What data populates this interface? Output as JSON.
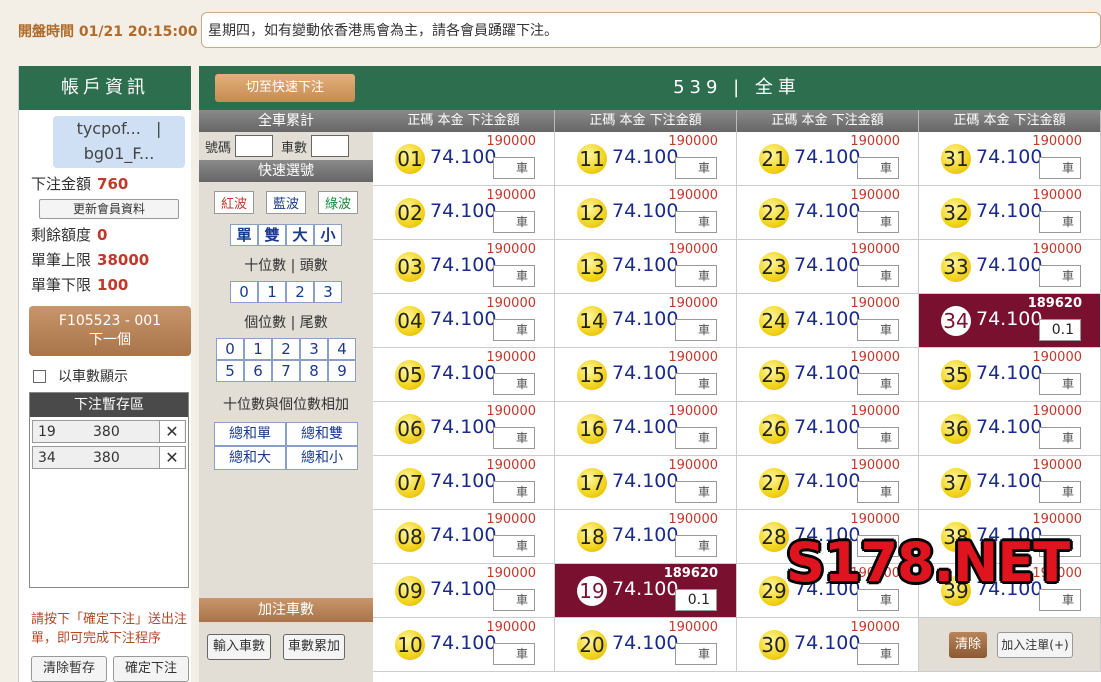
{
  "header": {
    "open_time": "開盤時間 01/21 20:15:00",
    "notice": "星期四，如有變動依香港馬會為主，請各會員踴躍下注。"
  },
  "account": {
    "title": "帳戶資訊",
    "user_line1": "tycpof...",
    "user_sep": "|",
    "user_line2": "bg01_F...",
    "bet_amount_label": "下注金額",
    "bet_amount": "760",
    "update_btn": "更新會員資料",
    "remaining_label": "剩餘額度",
    "remaining": "0",
    "max_label": "單筆上限",
    "max": "38000",
    "min_label": "單筆下限",
    "min": "100",
    "next_line1": "F105523 - 001",
    "next_line2": "下一個",
    "show_by_count": "以車數顯示",
    "staging_title": "下注暫存區",
    "staging": [
      {
        "num": "19",
        "amt": "380"
      },
      {
        "num": "34",
        "amt": "380"
      }
    ],
    "note": "請按下「確定下注」送出注單，即可完成下注程序",
    "clear_btn": "清除暫存",
    "confirm_btn": "確定下注"
  },
  "quick": {
    "fast_btn": "切至快速下注",
    "total_title": "全車累計",
    "num_label": "號碼",
    "count_label": "車數",
    "quick_title": "快速選號",
    "waves": [
      "紅波",
      "藍波",
      "綠波"
    ],
    "parity": [
      "單",
      "雙",
      "大",
      "小"
    ],
    "tens_label": "十位數 | 頭數",
    "tens": [
      "0",
      "1",
      "2",
      "3"
    ],
    "units_label": "個位數 | 尾數",
    "units_row1": [
      "0",
      "1",
      "2",
      "3",
      "4"
    ],
    "units_row2": [
      "5",
      "6",
      "7",
      "8",
      "9"
    ],
    "sum_label": "十位數與個位數相加",
    "sums": [
      "總和單",
      "總和雙",
      "總和大",
      "總和小"
    ],
    "add_title": "加注車數",
    "input_btn": "輸入車數",
    "accum_btn": "車數累加"
  },
  "board": {
    "title": "539 | 全車",
    "col_head": "正碼  本金  下注金額",
    "car_label": "車",
    "clear_btn": "清除",
    "add_btn": "加入注單(+)",
    "columns": [
      [
        {
          "n": "01",
          "odds": "74.100",
          "limit": "190000",
          "val": ""
        },
        {
          "n": "02",
          "odds": "74.100",
          "limit": "190000",
          "val": ""
        },
        {
          "n": "03",
          "odds": "74.100",
          "limit": "190000",
          "val": ""
        },
        {
          "n": "04",
          "odds": "74.100",
          "limit": "190000",
          "val": ""
        },
        {
          "n": "05",
          "odds": "74.100",
          "limit": "190000",
          "val": ""
        },
        {
          "n": "06",
          "odds": "74.100",
          "limit": "190000",
          "val": ""
        },
        {
          "n": "07",
          "odds": "74.100",
          "limit": "190000",
          "val": ""
        },
        {
          "n": "08",
          "odds": "74.100",
          "limit": "190000",
          "val": ""
        },
        {
          "n": "09",
          "odds": "74.100",
          "limit": "190000",
          "val": ""
        },
        {
          "n": "10",
          "odds": "74.100",
          "limit": "190000",
          "val": ""
        }
      ],
      [
        {
          "n": "11",
          "odds": "74.100",
          "limit": "190000",
          "val": ""
        },
        {
          "n": "12",
          "odds": "74.100",
          "limit": "190000",
          "val": ""
        },
        {
          "n": "13",
          "odds": "74.100",
          "limit": "190000",
          "val": ""
        },
        {
          "n": "14",
          "odds": "74.100",
          "limit": "190000",
          "val": ""
        },
        {
          "n": "15",
          "odds": "74.100",
          "limit": "190000",
          "val": ""
        },
        {
          "n": "16",
          "odds": "74.100",
          "limit": "190000",
          "val": ""
        },
        {
          "n": "17",
          "odds": "74.100",
          "limit": "190000",
          "val": ""
        },
        {
          "n": "18",
          "odds": "74.100",
          "limit": "190000",
          "val": ""
        },
        {
          "n": "19",
          "odds": "74.100",
          "limit": "189620",
          "val": "0.1",
          "selected": true
        },
        {
          "n": "20",
          "odds": "74.100",
          "limit": "190000",
          "val": ""
        }
      ],
      [
        {
          "n": "21",
          "odds": "74.100",
          "limit": "190000",
          "val": ""
        },
        {
          "n": "22",
          "odds": "74.100",
          "limit": "190000",
          "val": ""
        },
        {
          "n": "23",
          "odds": "74.100",
          "limit": "190000",
          "val": ""
        },
        {
          "n": "24",
          "odds": "74.100",
          "limit": "190000",
          "val": ""
        },
        {
          "n": "25",
          "odds": "74.100",
          "limit": "190000",
          "val": ""
        },
        {
          "n": "26",
          "odds": "74.100",
          "limit": "190000",
          "val": ""
        },
        {
          "n": "27",
          "odds": "74.100",
          "limit": "190000",
          "val": ""
        },
        {
          "n": "28",
          "odds": "74.100",
          "limit": "190000",
          "val": ""
        },
        {
          "n": "29",
          "odds": "74.100",
          "limit": "190000",
          "val": ""
        },
        {
          "n": "30",
          "odds": "74.100",
          "limit": "190000",
          "val": ""
        }
      ],
      [
        {
          "n": "31",
          "odds": "74.100",
          "limit": "190000",
          "val": ""
        },
        {
          "n": "32",
          "odds": "74.100",
          "limit": "190000",
          "val": ""
        },
        {
          "n": "33",
          "odds": "74.100",
          "limit": "190000",
          "val": ""
        },
        {
          "n": "34",
          "odds": "74.100",
          "limit": "189620",
          "val": "0.1",
          "selected": true
        },
        {
          "n": "35",
          "odds": "74.100",
          "limit": "190000",
          "val": ""
        },
        {
          "n": "36",
          "odds": "74.100",
          "limit": "190000",
          "val": ""
        },
        {
          "n": "37",
          "odds": "74.100",
          "limit": "190000",
          "val": ""
        },
        {
          "n": "38",
          "odds": "74.100",
          "limit": "190000",
          "val": ""
        },
        {
          "n": "39",
          "odds": "74.100",
          "limit": "190000",
          "val": ""
        }
      ]
    ]
  },
  "watermark": "S178.NET"
}
